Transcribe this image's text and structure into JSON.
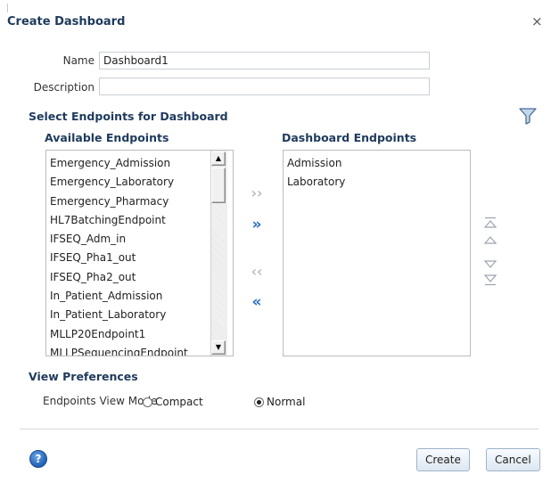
{
  "dialog": {
    "title": "Create Dashboard",
    "close_icon": "×"
  },
  "form": {
    "name_label": "Name",
    "name_value": "Dashboard1",
    "description_label": "Description",
    "description_value": ""
  },
  "endpoints": {
    "section_title": "Select Endpoints for Dashboard",
    "filter_icon": "filter-icon",
    "available_title": "Available Endpoints",
    "dashboard_title": "Dashboard Endpoints",
    "available_items": [
      "Emergency_Admission",
      "Emergency_Laboratory",
      "Emergency_Pharmacy",
      "HL7BatchingEndpoint",
      "IFSEQ_Adm_in",
      "IFSEQ_Pha1_out",
      "IFSEQ_Pha2_out",
      "In_Patient_Admission",
      "In_Patient_Laboratory",
      "MLLP20Endpoint1",
      "MLLPSequencingEndpoint"
    ],
    "dashboard_items": [
      "Admission",
      "Laboratory"
    ]
  },
  "view_preferences": {
    "section_title": "View Preferences",
    "mode_label": "Endpoints View Mode",
    "options": [
      {
        "label": "Compact",
        "selected": false
      },
      {
        "label": "Normal",
        "selected": true
      }
    ]
  },
  "footer": {
    "help_icon": "?",
    "create_label": "Create",
    "cancel_label": "Cancel"
  },
  "colors": {
    "heading": "#1e3a5c",
    "shuttle_active": "#2c71c7",
    "shuttle_inactive": "#a9a9a9"
  }
}
